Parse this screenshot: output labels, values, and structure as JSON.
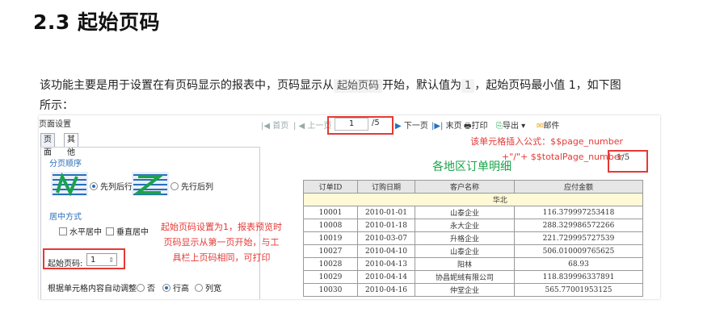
{
  "heading": "2.3 起始页码",
  "para": {
    "text1": "该功能主要是用于设置在有页码显示的报表中，页码显示从",
    "code1": "起始页码",
    "text2": "开始，默认值为",
    "code2": "1",
    "text3": "，起始页码最小值 1，如下图",
    "line2": "所示："
  },
  "dialog": {
    "title": "页面设置",
    "tabs": [
      "页面",
      "其他"
    ],
    "section_pagination": "分页顺序",
    "opt_col_first": "先列后行",
    "opt_row_first": "先行后列",
    "section_center": "居中方式",
    "opt_h_center": "水平居中",
    "opt_v_center": "垂直居中",
    "start_page_label": "起始页码:",
    "start_page_value": "1",
    "autofit_label": "根据单元格内容自动调整",
    "opt_no": "否",
    "opt_row_height": "行高",
    "opt_col_width": "列宽"
  },
  "annot_left": [
    "起始页码设置为1，报表预览时",
    "页码显示从第一页开始，与工",
    "具栏上页码相同，可打印"
  ],
  "annot_right": [
    "该单元格插入公式：$$page_number",
    "+\"/\"+ $$totalPage_number"
  ],
  "toolbar": {
    "first": "首页",
    "prev": "上一页",
    "page_value": "1",
    "total": "/5",
    "next": "下一页",
    "last": "末页",
    "print": "打印",
    "export": "导出",
    "mail": "邮件"
  },
  "page_indicator": "1/5",
  "report": {
    "title": "各地区订单明细",
    "columns": [
      "订单ID",
      "订购日期",
      "客户名称",
      "应付金额"
    ],
    "group": "华北",
    "rows": [
      [
        "10001",
        "2010-01-01",
        "山泰企业",
        "116.379997253418"
      ],
      [
        "10008",
        "2010-01-18",
        "永大企业",
        "288.329986572266"
      ],
      [
        "10019",
        "2010-03-07",
        "升格企业",
        "221.729995727539"
      ],
      [
        "10027",
        "2010-04-10",
        "山泰企业",
        "506.010009765625"
      ],
      [
        "10028",
        "2010-04-13",
        "阳林",
        "68.93"
      ],
      [
        "10029",
        "2010-04-14",
        "协昌妮绒有限公司",
        "118.839996337891"
      ],
      [
        "10030",
        "2010-04-16",
        "仲堂企业",
        "565.77001953125"
      ]
    ]
  },
  "colors": {
    "annotation": "#e53935",
    "link": "#2a6fb8",
    "title_green": "#1aa34a"
  }
}
